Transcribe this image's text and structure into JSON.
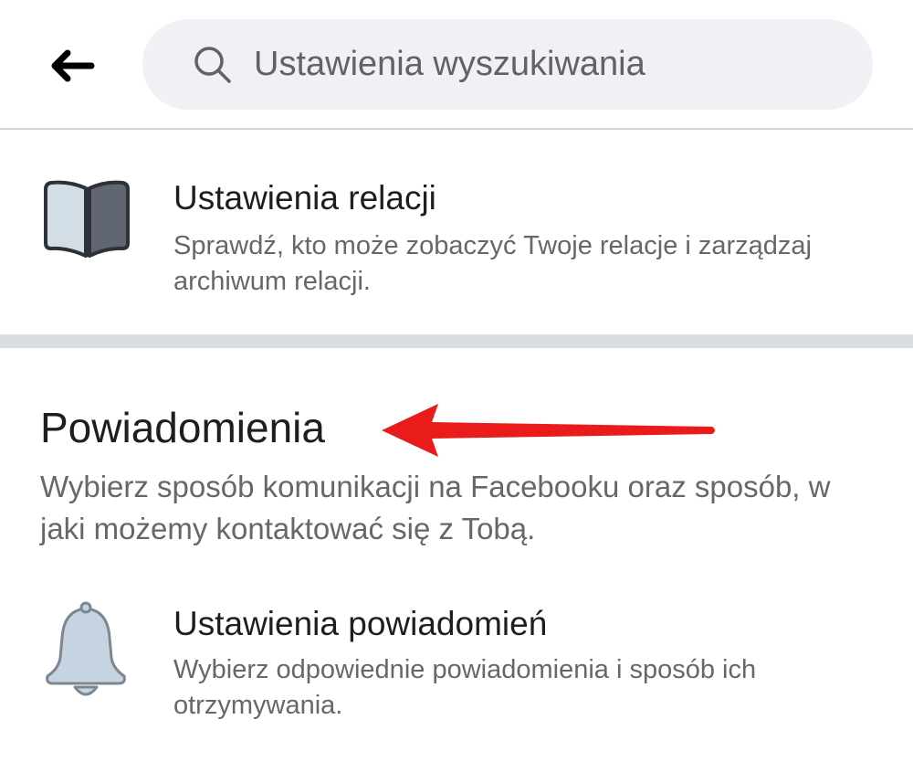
{
  "search": {
    "placeholder": "Ustawienia wyszukiwania"
  },
  "icons": {
    "back": "back-arrow-icon",
    "search": "search-icon",
    "stories": "book-icon",
    "notifications": "bell-icon"
  },
  "stories_row": {
    "title": "Ustawienia relacji",
    "description": "Sprawdź, kto może zobaczyć Twoje relacje i zarządzaj archiwum relacji."
  },
  "notifications_section": {
    "title": "Powiadomienia",
    "description": "Wybierz sposób komunikacji na Facebooku oraz sposób, w jaki możemy kontaktować się z Tobą."
  },
  "notifications_row": {
    "title": "Ustawienia powiadomień",
    "description": "Wybierz odpowiednie powiadomienia i sposób ich otrzymywania."
  },
  "colors": {
    "annotation_arrow": "#ea1b1b",
    "search_background": "#eff1f4",
    "divider": "#dadde1"
  }
}
